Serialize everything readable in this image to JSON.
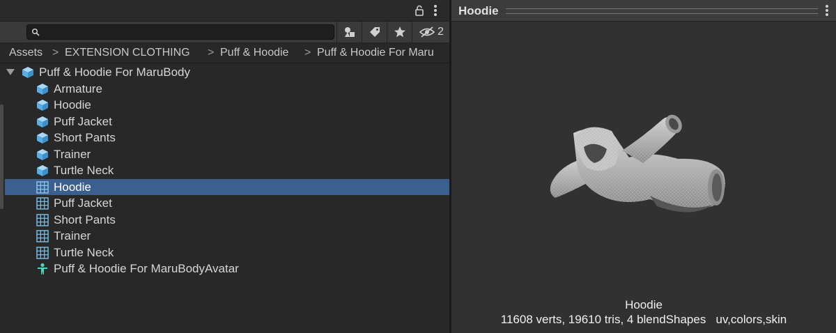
{
  "project_panel": {
    "search": {
      "value": "",
      "placeholder": ""
    },
    "hidden_count": "2",
    "breadcrumbs": [
      "Assets",
      "EXTENSION CLOTHING",
      "Puff & Hoodie",
      "Puff & Hoodie For Maru"
    ],
    "root": {
      "label": "Puff & Hoodie For MaruBody",
      "icon": "prefab-icon"
    },
    "items": [
      {
        "label": "Armature",
        "icon": "prefab-icon"
      },
      {
        "label": "Hoodie",
        "icon": "prefab-icon"
      },
      {
        "label": "Puff Jacket",
        "icon": "prefab-icon"
      },
      {
        "label": "Short Pants",
        "icon": "prefab-icon"
      },
      {
        "label": "Trainer",
        "icon": "prefab-icon"
      },
      {
        "label": "Turtle Neck",
        "icon": "prefab-icon"
      },
      {
        "label": "Hoodie",
        "icon": "mesh-icon",
        "selected": true
      },
      {
        "label": "Puff Jacket",
        "icon": "mesh-icon"
      },
      {
        "label": "Short Pants",
        "icon": "mesh-icon"
      },
      {
        "label": "Trainer",
        "icon": "mesh-icon"
      },
      {
        "label": "Turtle Neck",
        "icon": "mesh-icon"
      },
      {
        "label": "Puff & Hoodie For MaruBodyAvatar",
        "icon": "avatar-icon"
      }
    ]
  },
  "preview_panel": {
    "title": "Hoodie",
    "mesh_name": "Hoodie",
    "mesh_stats": "11608 verts, 19610 tris, 4 blendShapes   uv,colors,skin"
  },
  "colors": {
    "selection": "#3b5f8f",
    "prefab": "#6fb6e8",
    "mesh": "#7fc2ec",
    "avatar": "#4fd4c0"
  }
}
